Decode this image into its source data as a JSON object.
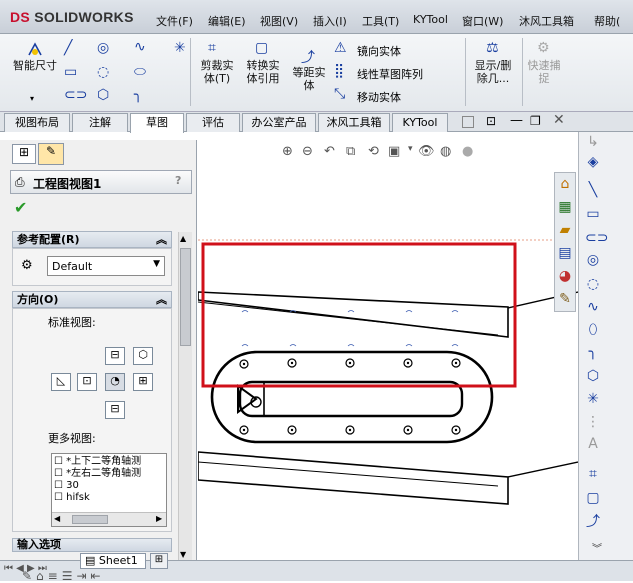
{
  "app": {
    "logo_prefix": "DS",
    "logo_text": "SOLIDWORKS"
  },
  "menu": [
    "文件(F)",
    "编辑(E)",
    "视图(V)",
    "插入(I)",
    "工具(T)",
    "KYTool",
    "窗口(W)",
    "沐风工具箱",
    "帮助("
  ],
  "ribbon": {
    "smart_dim": "智能尺寸",
    "trim": "剪裁实体(T)",
    "convert": "转换实体引用",
    "offset": "等距实体",
    "mirror": "镜向实体",
    "linear_pattern": "线性草图阵列",
    "move": "移动实体",
    "show_delete": "显示/删除几...",
    "quick_snap": "快速捕捉"
  },
  "tabs": [
    "视图布局",
    "注解",
    "草图",
    "评估",
    "办公室产品",
    "沐风工具箱",
    "KYTool"
  ],
  "active_tab": "草图",
  "panel": {
    "title": "工程图视图1",
    "help": "?",
    "ref_config_header": "参考配置(R)",
    "config_value": "Default",
    "orientation_header": "方向(O)",
    "standard_views_label": "标准视图:",
    "more_views_label": "更多视图:",
    "more_views": [
      "*上下二等角轴测",
      "*左右二等角轴测",
      "30",
      "hifsk"
    ],
    "input_options_header": "输入选项"
  },
  "status": {
    "sheet": "Sheet1"
  },
  "colors": {
    "highlight_box": "#d0101a",
    "accent": "#1a3fa0",
    "logo": "#c8102e"
  }
}
